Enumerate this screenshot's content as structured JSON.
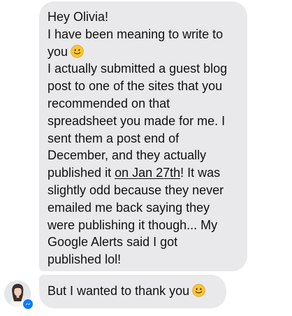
{
  "conversation": {
    "messages": [
      {
        "sender": "incoming",
        "lines": [
          {
            "text": "Hey Olivia!"
          },
          {
            "text": "I have been meaning to write to"
          },
          {
            "text": "you",
            "emoji": "slightly-smiling-face-icon"
          },
          {
            "text": "I actually submitted a guest blog"
          },
          {
            "text": "post to one of the sites that you"
          },
          {
            "text": "recommended on that"
          },
          {
            "text": "spreadsheet you made for me. I"
          },
          {
            "text": "sent them a post end of"
          },
          {
            "text": "December, and they actually"
          },
          {
            "before": "published it ",
            "link": "on Jan 27th",
            "after": "! It was"
          },
          {
            "text": "slightly odd because they never"
          },
          {
            "text": "emailed me back saying they"
          },
          {
            "text": "were publishing it though... My"
          },
          {
            "text": "Google Alerts said I got"
          },
          {
            "text": "published lol!"
          }
        ]
      },
      {
        "sender": "incoming",
        "text": "But I wanted to thank you",
        "emoji": "slightly-smiling-face-icon"
      }
    ],
    "sender_avatar": {
      "icon": "profile-photo",
      "badge_icon": "messenger-badge-icon",
      "badge_color": "#0a7cff"
    },
    "bubble_color": "#e9e9eb",
    "text_color": "#111111"
  }
}
